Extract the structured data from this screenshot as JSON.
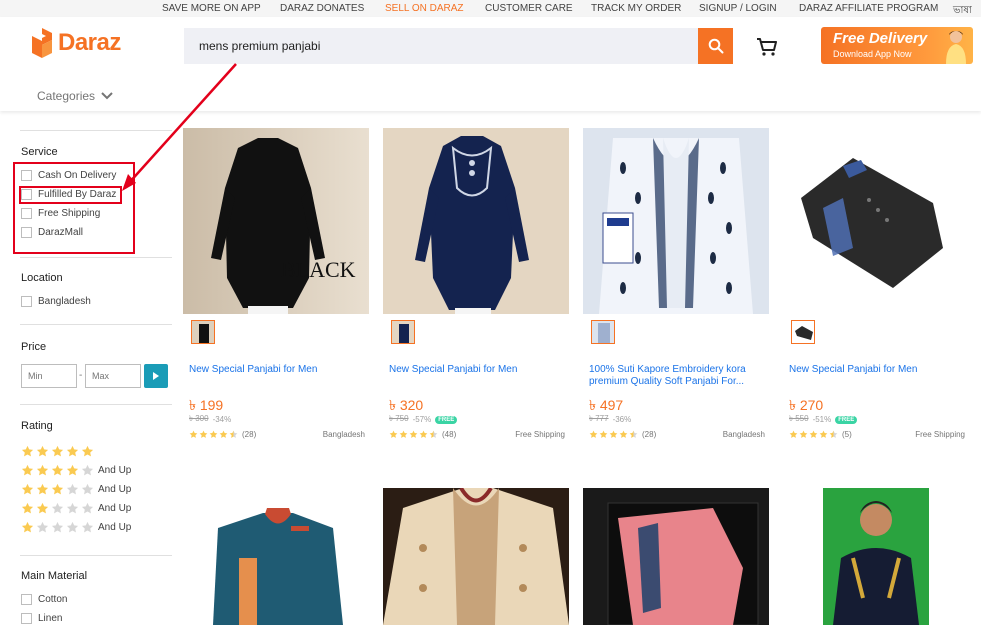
{
  "topbar": {
    "links": [
      {
        "label": "SAVE MORE ON APP"
      },
      {
        "label": "DARAZ DONATES"
      },
      {
        "label": "SELL ON DARAZ"
      },
      {
        "label": "CUSTOMER CARE"
      },
      {
        "label": "TRACK MY ORDER"
      },
      {
        "label": "SIGNUP / LOGIN"
      },
      {
        "label": "DARAZ AFFILIATE PROGRAM"
      },
      {
        "label": "ভাষা"
      }
    ]
  },
  "header": {
    "logo_text": "Daraz",
    "search_value": "mens premium panjabi",
    "promo_title": "Free Delivery",
    "promo_sub": "Download App Now",
    "categories_label": "Categories"
  },
  "filters": {
    "service": {
      "title": "Service",
      "options": [
        "Cash On Delivery",
        "Fulfilled By Daraz",
        "Free Shipping",
        "DarazMall"
      ]
    },
    "location": {
      "title": "Location",
      "options": [
        "Bangladesh"
      ]
    },
    "price": {
      "title": "Price",
      "min_placeholder": "Min",
      "max_placeholder": "Max",
      "separator": "-"
    },
    "rating": {
      "title": "Rating",
      "levels": [
        5,
        4,
        3,
        2,
        1
      ],
      "and_up": "And Up"
    },
    "material": {
      "title": "Main Material",
      "options": [
        "Cotton",
        "Linen"
      ]
    }
  },
  "products": [
    {
      "title": "New Special Panjabi for Men",
      "price": "৳ 199",
      "original": "৳ 300",
      "discount": "-34%",
      "free": false,
      "reviews": "(28)",
      "stars": 4.5,
      "location": "Bangladesh",
      "image_text": "BLACK"
    },
    {
      "title": "New Special Panjabi for Men",
      "price": "৳ 320",
      "original": "৳ 750",
      "discount": "-57%",
      "free": true,
      "reviews": "(48)",
      "stars": 4.5,
      "location": "Free Shipping"
    },
    {
      "title": "100% Suti Kapore Embroidery kora premium Quality Soft Panjabi For...",
      "price": "৳ 497",
      "original": "৳ 777",
      "discount": "-36%",
      "free": false,
      "reviews": "(28)",
      "stars": 4.5,
      "location": "Bangladesh"
    },
    {
      "title": "New Special Panjabi for Men",
      "price": "৳ 270",
      "original": "৳ 550",
      "discount": "-51%",
      "free": true,
      "reviews": "(5)",
      "stars": 4.5,
      "location": "Free Shipping"
    }
  ],
  "free_badge": "FREE",
  "colors": {
    "brand": "#f57224",
    "link": "#1a73e8",
    "annotation": "#e3001b",
    "free_badge": "#3ad4a4",
    "star": "#faca51"
  }
}
